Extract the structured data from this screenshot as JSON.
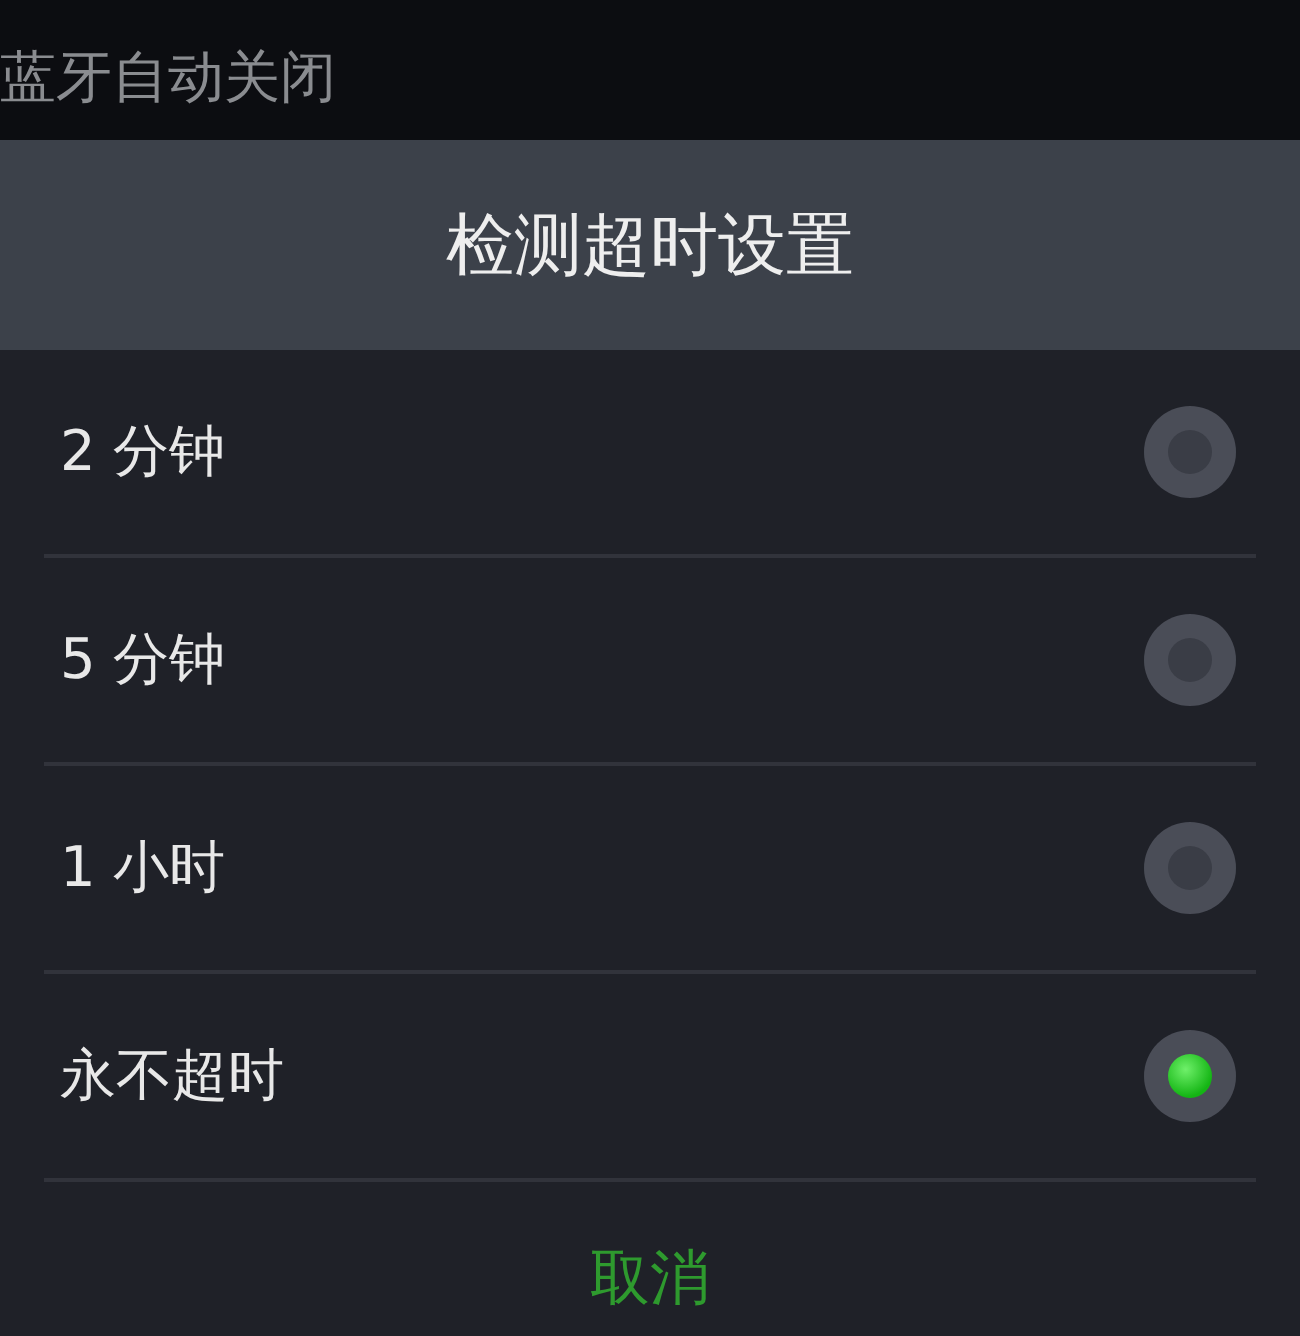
{
  "background": {
    "title": "蓝牙自动关闭"
  },
  "dialog": {
    "title": "检测超时设置",
    "options": [
      {
        "label": "2 分钟",
        "selected": false
      },
      {
        "label": "5 分钟",
        "selected": false
      },
      {
        "label": "1 小时",
        "selected": false
      },
      {
        "label": "永不超时",
        "selected": true
      }
    ],
    "buttons": [
      "取消"
    ]
  }
}
